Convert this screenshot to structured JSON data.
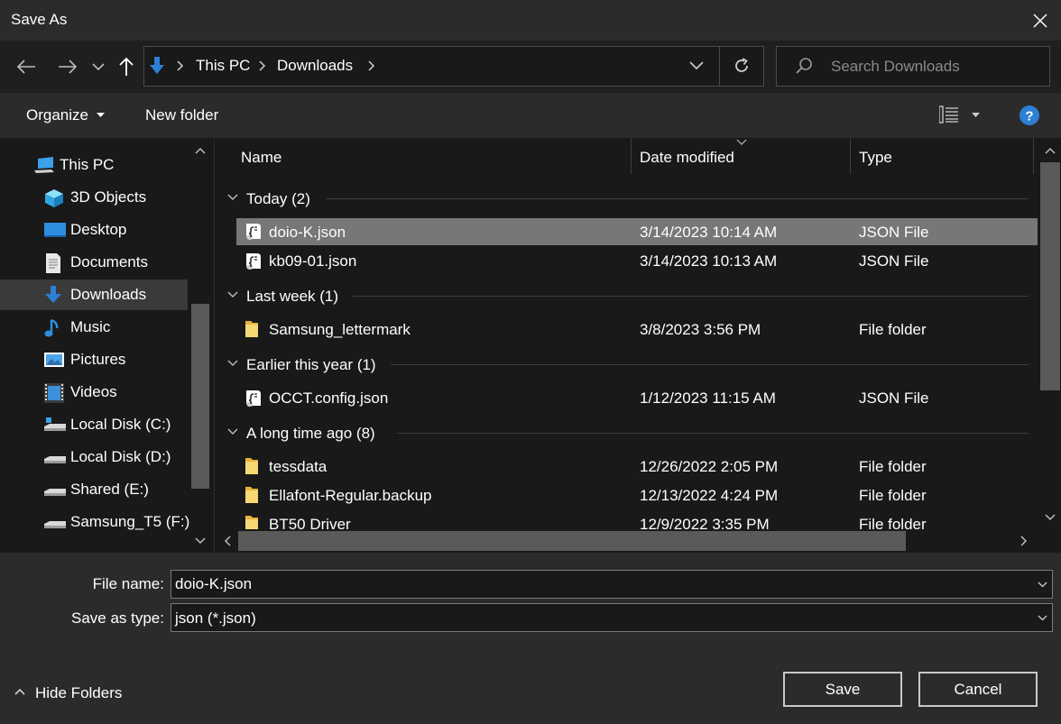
{
  "window": {
    "title": "Save As"
  },
  "breadcrumb": [
    "This PC",
    "Downloads"
  ],
  "search": {
    "placeholder": "Search Downloads"
  },
  "commands": {
    "organize": "Organize",
    "new_folder": "New folder"
  },
  "sidebar": {
    "items": [
      {
        "label": "This PC",
        "icon": "computer-icon"
      },
      {
        "label": "3D Objects",
        "icon": "cube-icon"
      },
      {
        "label": "Desktop",
        "icon": "desktop-icon"
      },
      {
        "label": "Documents",
        "icon": "document-icon"
      },
      {
        "label": "Downloads",
        "icon": "download-icon",
        "selected": true
      },
      {
        "label": "Music",
        "icon": "music-icon"
      },
      {
        "label": "Pictures",
        "icon": "pictures-icon"
      },
      {
        "label": "Videos",
        "icon": "video-icon"
      },
      {
        "label": "Local Disk (C:)",
        "icon": "drive-icon"
      },
      {
        "label": "Local Disk (D:)",
        "icon": "drive-icon"
      },
      {
        "label": "Shared (E:)",
        "icon": "drive-icon"
      },
      {
        "label": "Samsung_T5 (F:)",
        "icon": "drive-icon"
      }
    ]
  },
  "columns": {
    "name": "Name",
    "date": "Date modified",
    "type": "Type"
  },
  "groups": [
    {
      "label": "Today (2)",
      "files": [
        {
          "name": "doio-K.json",
          "date": "3/14/2023 10:14 AM",
          "type": "JSON File",
          "icon": "json-file-icon",
          "selected": true
        },
        {
          "name": "kb09-01.json",
          "date": "3/14/2023 10:13 AM",
          "type": "JSON File",
          "icon": "json-file-icon"
        }
      ]
    },
    {
      "label": "Last week (1)",
      "files": [
        {
          "name": "Samsung_lettermark",
          "date": "3/8/2023 3:56 PM",
          "type": "File folder",
          "icon": "folder-icon"
        }
      ]
    },
    {
      "label": "Earlier this year (1)",
      "files": [
        {
          "name": "OCCT.config.json",
          "date": "1/12/2023 11:15 AM",
          "type": "JSON File",
          "icon": "json-file-icon"
        }
      ]
    },
    {
      "label": "A long time ago (8)",
      "files": [
        {
          "name": "tessdata",
          "date": "12/26/2022 2:05 PM",
          "type": "File folder",
          "icon": "folder-icon"
        },
        {
          "name": "Ellafont-Regular.backup",
          "date": "12/13/2022 4:24 PM",
          "type": "File folder",
          "icon": "folder-icon"
        },
        {
          "name": "BT50 Driver",
          "date": "12/9/2022 3:35 PM",
          "type": "File folder",
          "icon": "folder-icon"
        }
      ]
    }
  ],
  "form": {
    "filename_label": "File name:",
    "filename_value": "doio-K.json",
    "type_label": "Save as type:",
    "type_value": "json (*.json)"
  },
  "footer": {
    "hide_folders": "Hide Folders",
    "save": "Save",
    "cancel": "Cancel"
  },
  "colors": {
    "accent": "#2d7fd3",
    "selection": "#777777",
    "background": "#191919"
  }
}
